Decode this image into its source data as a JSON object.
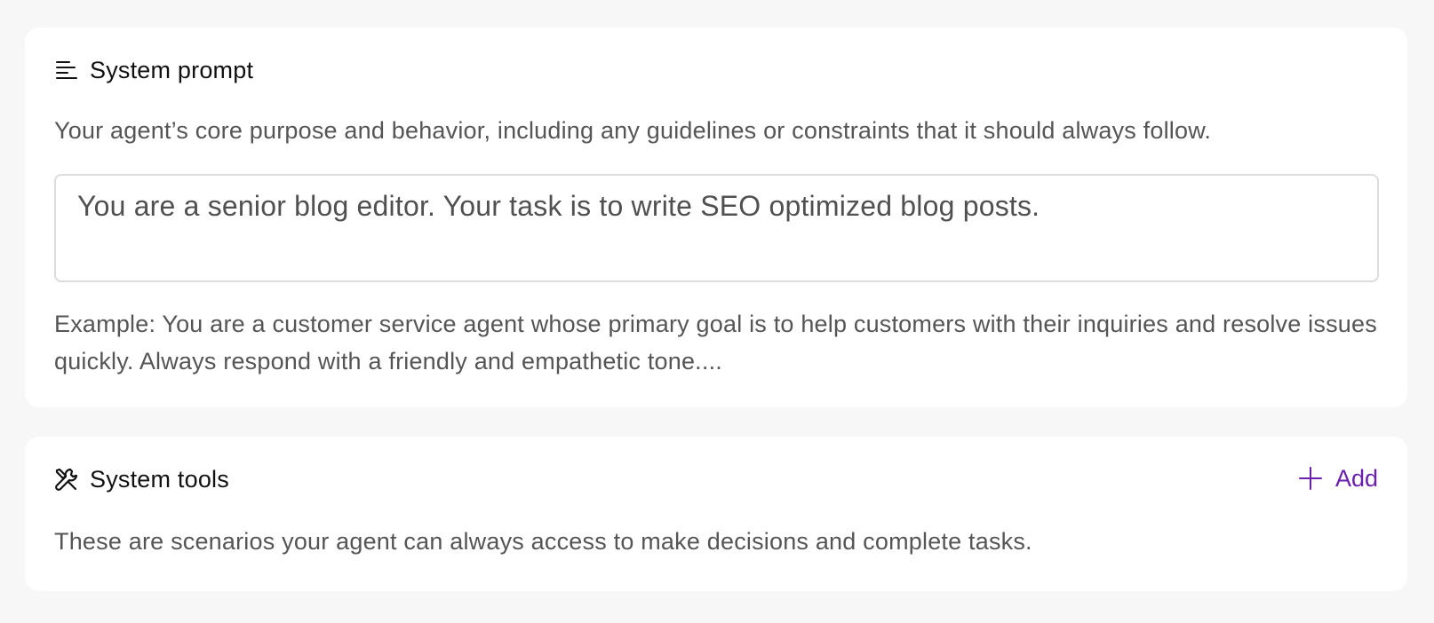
{
  "system_prompt": {
    "title": "System prompt",
    "icon": "align-left-icon",
    "description": "Your agent’s core purpose and behavior, including any guidelines or constraints that it should always follow.",
    "input_value": "You are a senior blog editor. Your task is to write SEO optimized blog posts.",
    "example_text": "Example: You are a customer service agent whose primary goal is to help customers with their inquiries and resolve issues quickly. Always respond with a friendly and empathetic tone...."
  },
  "system_tools": {
    "title": "System tools",
    "icon": "tools-icon",
    "description": "These are scenarios your agent can always access to make decisions and complete tasks.",
    "add_label": "Add",
    "add_icon": "plus-icon"
  },
  "colors": {
    "accent": "#6b1fae",
    "background": "#f7f7f7",
    "card": "#ffffff",
    "muted_text": "#555555"
  }
}
